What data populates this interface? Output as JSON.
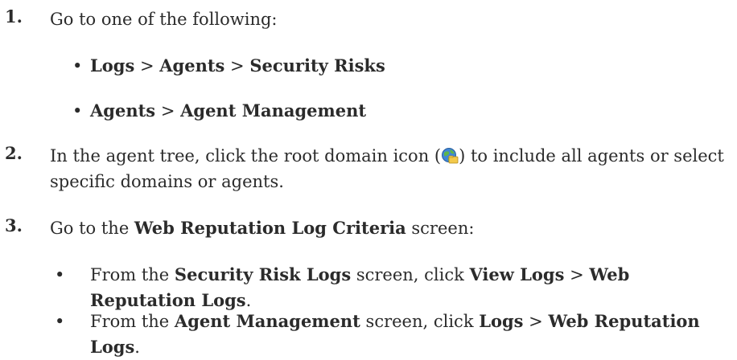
{
  "steps": [
    {
      "number": "1.",
      "text": "Go to one of the following:",
      "items": [
        {
          "a": "Logs",
          "sep1": " > ",
          "b": "Agents",
          "sep2": " > ",
          "c": "Security Risks"
        },
        {
          "a": "Agents",
          "sep1": " > ",
          "b": "Agent Management"
        }
      ]
    },
    {
      "number": "2.",
      "pre": "In the agent tree, click the root domain icon (",
      "post": ") to include all agents or select specific domains or agents.",
      "icon": "globe-folder-icon"
    },
    {
      "number": "3.",
      "pre": "Go to the ",
      "bold": "Web Reputation Log Criteria",
      "post": " screen:",
      "items": [
        {
          "p1": "From the ",
          "b1": "Security Risk Logs",
          "p2": " screen, click ",
          "b2": "View Logs",
          "p3": " > ",
          "b3": "Web Reputation Logs",
          "p4": "."
        },
        {
          "p1": "From the ",
          "b1": "Agent Management",
          "p2": " screen, click ",
          "b2": "Logs",
          "p3": " > ",
          "b3": "Web Reputation Logs",
          "p4": "."
        }
      ]
    }
  ],
  "bullet": "•"
}
